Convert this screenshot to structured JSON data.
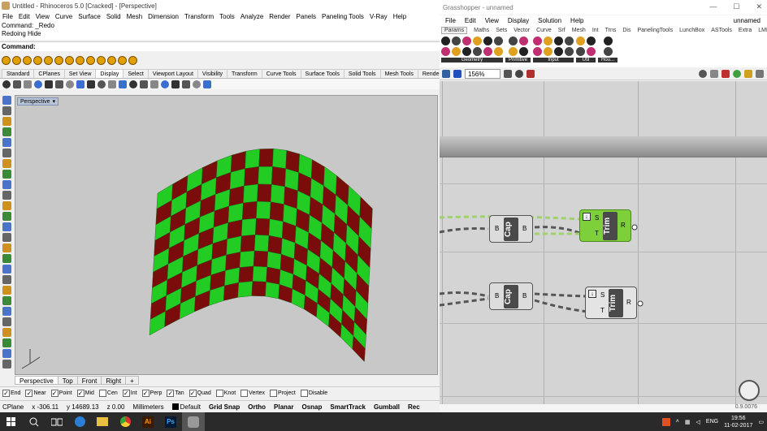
{
  "rhino": {
    "title": "Untitled - Rhinoceros 5.0 [Cracked] - [Perspective]",
    "menu": [
      "File",
      "Edit",
      "View",
      "Curve",
      "Surface",
      "Solid",
      "Mesh",
      "Dimension",
      "Transform",
      "Tools",
      "Analyze",
      "Render",
      "Panels",
      "Paneling Tools",
      "V-Ray",
      "Help"
    ],
    "history": [
      "Command: _Redo",
      "Redoing Hide"
    ],
    "command_label": "Command:",
    "tabs": [
      "Standard",
      "CPlanes",
      "Set View",
      "Display",
      "Select",
      "Viewport Layout",
      "Visibility",
      "Transform",
      "Curve Tools",
      "Surface Tools",
      "Solid Tools",
      "Mesh Tools",
      "Render Too"
    ],
    "active_tab": "Display",
    "viewport_label": "Perspective",
    "viewport_tabs": [
      "Perspective",
      "Top",
      "Front",
      "Right"
    ],
    "osnaps": [
      {
        "label": "End",
        "checked": true
      },
      {
        "label": "Near",
        "checked": true
      },
      {
        "label": "Point",
        "checked": true
      },
      {
        "label": "Mid",
        "checked": true
      },
      {
        "label": "Cen",
        "checked": false
      },
      {
        "label": "Int",
        "checked": true
      },
      {
        "label": "Perp",
        "checked": true
      },
      {
        "label": "Tan",
        "checked": true
      },
      {
        "label": "Quad",
        "checked": true
      },
      {
        "label": "Knot",
        "checked": false
      },
      {
        "label": "Vertex",
        "checked": false
      },
      {
        "label": "Project",
        "checked": false
      },
      {
        "label": "Disable",
        "checked": false
      }
    ],
    "status": {
      "cplane": "CPlane",
      "x": "x -306.11",
      "y": "y 14689.13",
      "z": "z 0.00",
      "units": "Millimeters",
      "layer": "Default",
      "toggles": [
        "Grid Snap",
        "Ortho",
        "Planar",
        "Osnap",
        "SmartTrack",
        "Gumball",
        "Rec"
      ]
    }
  },
  "grasshopper": {
    "title": "Grasshopper - unnamed",
    "window_controls": [
      "—",
      "☐",
      "✕"
    ],
    "menu": [
      "File",
      "Edit",
      "View",
      "Display",
      "Solution",
      "Help"
    ],
    "doc_name": "unnamed",
    "tabs": [
      "Params",
      "Maths",
      "Sets",
      "Vector",
      "Curve",
      "Srf",
      "Mesh",
      "Int",
      "Trns",
      "Dis",
      "PanelingTools",
      "LunchBox",
      "ASTools",
      "Extra",
      "LMN"
    ],
    "active_tab": "Params",
    "ribbon_groups": [
      "Geometry",
      "Primitive",
      "Input",
      "Util",
      "Hou..."
    ],
    "zoom": "156%",
    "components": [
      {
        "name": "Cap",
        "input": "B",
        "output": "B"
      },
      {
        "name": "Trim",
        "inputs": [
          "S",
          "T"
        ],
        "output": "R"
      },
      {
        "name": "Cap",
        "input": "B",
        "output": "B"
      },
      {
        "name": "Trim",
        "inputs": [
          "S",
          "T"
        ],
        "output": "R"
      }
    ],
    "version": "0.9.0076"
  },
  "taskbar": {
    "lang": "ENG",
    "time": "19:56",
    "date": "11-02-2017"
  },
  "colors": {
    "surface_green": "#22cc22",
    "surface_red": "#7a0c0c",
    "gh_canvas": "#d4d4d4",
    "wire_green": "#9fd26b"
  }
}
